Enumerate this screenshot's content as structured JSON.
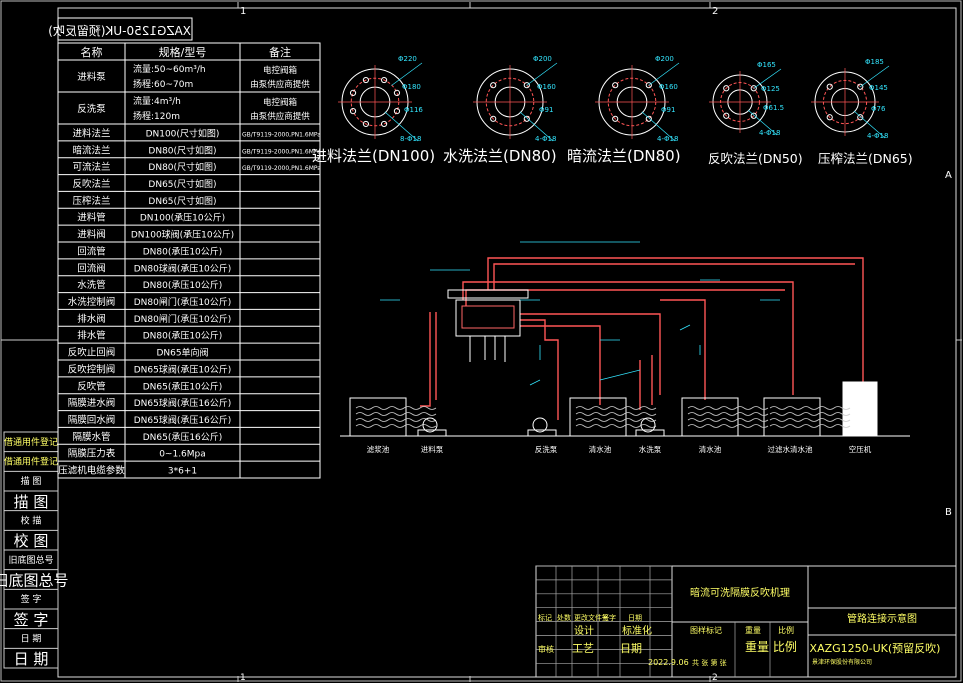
{
  "drawing_code_mirrored": "XAZG1250-UK(预留反吹)",
  "frame": {
    "col1": "1",
    "col2": "2",
    "rowA": "A",
    "rowB": "B"
  },
  "spec_table": {
    "headers": [
      "名称",
      "规格/型号",
      "备注"
    ],
    "rows": [
      {
        "name": "进料泵",
        "spec": "流量:50~60m³/h",
        "spec2": "扬程:60~70m",
        "note": "电控阀箱",
        "note2": "由泵供应商提供"
      },
      {
        "name": "反洗泵",
        "spec": "流量:4m³/h",
        "spec2": "扬程:120m",
        "note": "电控阀箱",
        "note2": "由泵供应商提供"
      },
      {
        "name": "进料法兰",
        "spec": "DN100(尺寸如图)",
        "note": "GB/T9119-2000,PN1.6MPa"
      },
      {
        "name": "暗流法兰",
        "spec": "DN80(尺寸如图)",
        "note": "GB/T9119-2000,PN1.6MPa"
      },
      {
        "name": "可流法兰",
        "spec": "DN80(尺寸如图)",
        "note": "GB/T9119-2000,PN1.6MPa"
      },
      {
        "name": "反吹法兰",
        "spec": "DN65(尺寸如图)",
        "note": ""
      },
      {
        "name": "压榨法兰",
        "spec": "DN65(尺寸如图)",
        "note": ""
      },
      {
        "name": "进料管",
        "spec": "DN100(承压10公斤)",
        "note": ""
      },
      {
        "name": "进料阀",
        "spec": "DN100球阀(承压10公斤)",
        "note": ""
      },
      {
        "name": "回流管",
        "spec": "DN80(承压10公斤)",
        "note": ""
      },
      {
        "name": "回流阀",
        "spec": "DN80球阀(承压10公斤)",
        "note": ""
      },
      {
        "name": "水洗管",
        "spec": "DN80(承压10公斤)",
        "note": ""
      },
      {
        "name": "水洗控制阀",
        "spec": "DN80闸门(承压10公斤)",
        "note": ""
      },
      {
        "name": "排水阀",
        "spec": "DN80闸门(承压10公斤)",
        "note": ""
      },
      {
        "name": "排水管",
        "spec": "DN80(承压10公斤)",
        "note": ""
      },
      {
        "name": "反吹止回阀",
        "spec": "DN65单向阀",
        "note": ""
      },
      {
        "name": "反吹控制阀",
        "spec": "DN65球阀(承压10公斤)",
        "note": ""
      },
      {
        "name": "反吹管",
        "spec": "DN65(承压10公斤)",
        "note": ""
      },
      {
        "name": "隔膜进水阀",
        "spec": "DN65球阀(承压16公斤)",
        "note": ""
      },
      {
        "name": "隔膜回水阀",
        "spec": "DN65球阀(承压16公斤)",
        "note": ""
      },
      {
        "name": "隔膜水管",
        "spec": "DN65(承压16公斤)",
        "note": ""
      },
      {
        "name": "隔膜压力表",
        "spec": "0~1.6Mpa",
        "note": ""
      },
      {
        "name": "压滤机电缆参数",
        "spec": "3*6+1",
        "note": ""
      }
    ]
  },
  "side_labels": [
    "借通用件登记",
    "借通用件登记",
    "描 图",
    "描 图",
    "校 描",
    "校 图",
    "旧底图总号",
    "旧底图总号",
    "签 字",
    "签 字",
    "日 期",
    "日 期"
  ],
  "flanges": [
    {
      "caption": "进料法兰(DN100)",
      "dims": [
        "Φ220",
        "Φ180",
        "Φ116",
        "8-Φ18"
      ]
    },
    {
      "caption": "水洗法兰(DN80)",
      "dims": [
        "Φ200",
        "Φ160",
        "Φ91",
        "4-Φ18"
      ]
    },
    {
      "caption": "暗流法兰(DN80)",
      "dims": [
        "Φ200",
        "Φ160",
        "Φ91",
        "4-Φ18"
      ]
    },
    {
      "caption": "反吹法兰(DN50)",
      "dims": [
        "Φ165",
        "Φ125",
        "Φ61.5",
        "4-Φ18"
      ]
    },
    {
      "caption": "压榨法兰(DN65)",
      "dims": [
        "Φ185",
        "Φ145",
        "Φ76",
        "4-Φ18"
      ]
    }
  ],
  "equipment_labels": [
    "滤浆池",
    "进料泵",
    "反洗泵",
    "清水池",
    "水洗泵",
    "清水池",
    "过滤水清水池",
    "空压机"
  ],
  "title_block": {
    "project": "暗流可洗隔膜反吹机理",
    "drawing_title": "管路连接示意图",
    "drawing_code": "XAZG1250-UK(预留反吹)",
    "grid_labels": [
      "标记",
      "处数",
      "更改文件号",
      "签字",
      "日期"
    ],
    "grid_labels2": [
      "设计",
      "标准化"
    ],
    "grid_labels3": [
      "图样标记",
      "重量",
      "比例"
    ],
    "grid_labels4": [
      "审核",
      "工艺",
      "日期"
    ],
    "date": "2022.9.06",
    "sheets": "共 张 第 张",
    "company": "景津环保股份有限公司"
  }
}
